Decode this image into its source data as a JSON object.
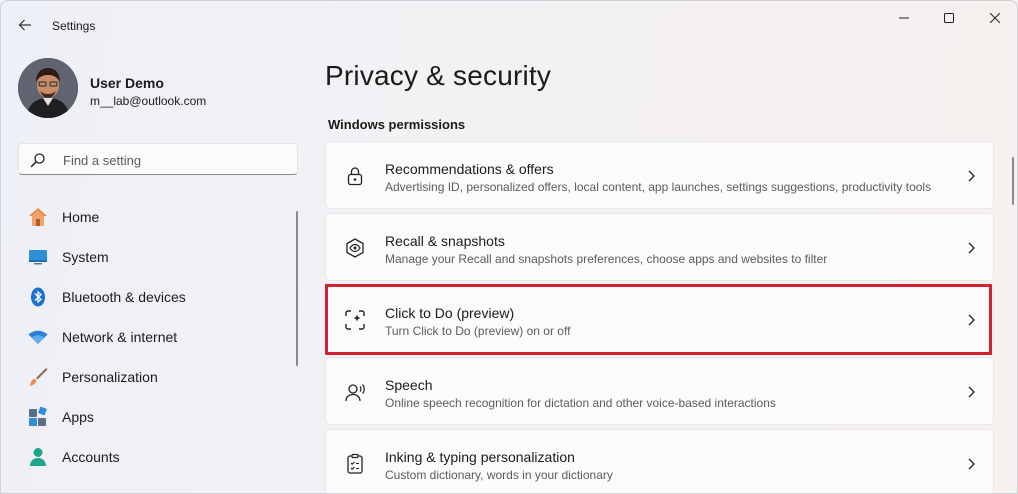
{
  "window": {
    "title": "Settings"
  },
  "user": {
    "name": "User Demo",
    "email": "m__lab@outlook.com"
  },
  "search": {
    "placeholder": "Find a setting"
  },
  "sidebar": {
    "items": [
      {
        "label": "Home",
        "icon": "home-icon"
      },
      {
        "label": "System",
        "icon": "system-icon"
      },
      {
        "label": "Bluetooth & devices",
        "icon": "bluetooth-icon"
      },
      {
        "label": "Network & internet",
        "icon": "wifi-icon"
      },
      {
        "label": "Personalization",
        "icon": "brush-icon"
      },
      {
        "label": "Apps",
        "icon": "apps-icon"
      },
      {
        "label": "Accounts",
        "icon": "accounts-icon"
      }
    ]
  },
  "main": {
    "title": "Privacy & security",
    "section": "Windows permissions",
    "cards": [
      {
        "title": "Recommendations & offers",
        "desc": "Advertising ID, personalized offers, local content, app launches, settings suggestions, productivity tools",
        "icon": "lock-icon"
      },
      {
        "title": "Recall & snapshots",
        "desc": "Manage your Recall and snapshots preferences, choose apps and websites to filter",
        "icon": "recall-icon"
      },
      {
        "title": "Click to Do (preview)",
        "desc": "Turn Click to Do (preview) on or off",
        "icon": "click-to-do-icon",
        "highlighted": true
      },
      {
        "title": "Speech",
        "desc": "Online speech recognition for dictation and other voice-based interactions",
        "icon": "speech-icon"
      },
      {
        "title": "Inking & typing personalization",
        "desc": "Custom dictionary, words in your dictionary",
        "icon": "inking-icon"
      }
    ]
  },
  "colors": {
    "highlight": "#d1202f",
    "accent": "#0067c0"
  }
}
